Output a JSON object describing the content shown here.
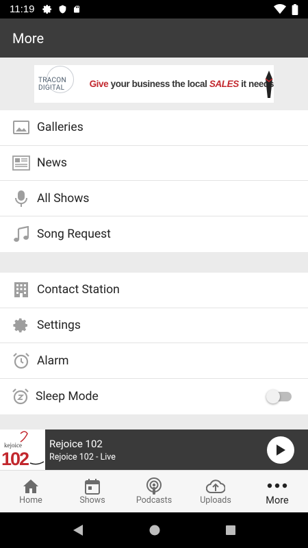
{
  "status_bar": {
    "time": "11:19"
  },
  "header": {
    "title": "More"
  },
  "banner": {
    "brand": "TRACON DIGITAL",
    "tagline_1": "Give ",
    "tagline_2": "your",
    "tagline_3": " business the local ",
    "tagline_4": "SALES",
    "tagline_5": " it needs"
  },
  "menu": {
    "group1": [
      {
        "label": "Galleries",
        "icon": "image-icon"
      },
      {
        "label": "News",
        "icon": "newspaper-icon"
      },
      {
        "label": "All Shows",
        "icon": "microphone-icon"
      },
      {
        "label": "Song Request",
        "icon": "music-note-icon"
      }
    ],
    "group2": [
      {
        "label": "Contact Station",
        "icon": "building-icon"
      },
      {
        "label": "Settings",
        "icon": "gear-icon"
      },
      {
        "label": "Alarm",
        "icon": "alarm-clock-icon"
      },
      {
        "label": "Sleep Mode",
        "icon": "sleep-clock-icon",
        "toggle": false
      }
    ]
  },
  "player": {
    "logo_text": "102",
    "logo_small": "kejoice",
    "title": "Rejoice 102",
    "subtitle": "Rejoice 102 - Live"
  },
  "bottom_nav": [
    {
      "label": "Home",
      "icon": "home-icon",
      "active": false
    },
    {
      "label": "Shows",
      "icon": "calendar-icon",
      "active": false
    },
    {
      "label": "Podcasts",
      "icon": "podcast-icon",
      "active": false
    },
    {
      "label": "Uploads",
      "icon": "cloud-upload-icon",
      "active": false
    },
    {
      "label": "More",
      "icon": "more-dots-icon",
      "active": true
    }
  ],
  "colors": {
    "app_bar": "#3c3c3c",
    "banner_red": "#c2272d",
    "player_bg": "#3a3a3a"
  }
}
